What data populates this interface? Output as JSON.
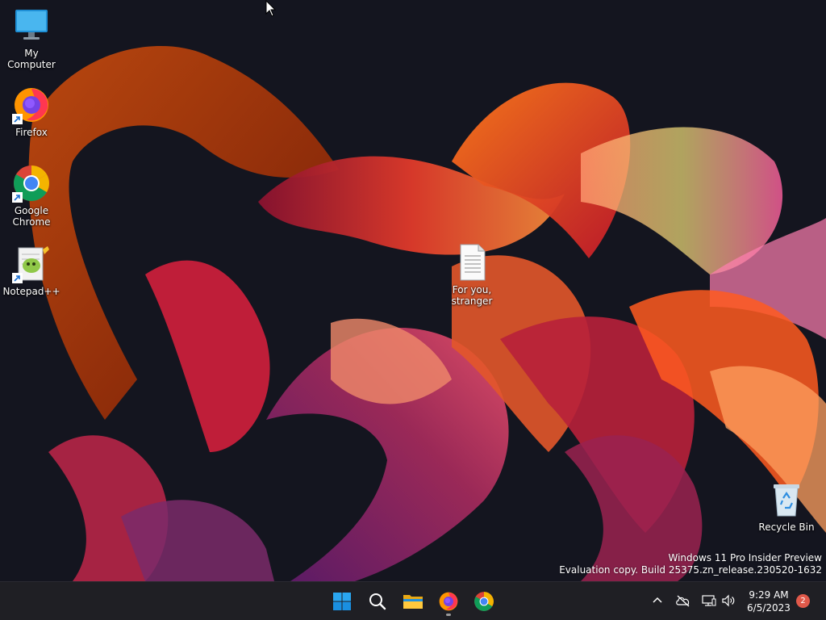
{
  "desktop": {
    "icons": [
      {
        "label": "My Computer",
        "icon": "monitor-icon"
      },
      {
        "label": "Firefox",
        "icon": "firefox-icon",
        "shortcut": true
      },
      {
        "label": "Google\nChrome",
        "icon": "chrome-icon",
        "shortcut": true
      },
      {
        "label": "Notepad++",
        "icon": "notepadplusplus-icon",
        "shortcut": true
      },
      {
        "label": "For you,\nstranger",
        "icon": "text-document-icon"
      },
      {
        "label": "Recycle Bin",
        "icon": "recycle-bin-icon"
      }
    ],
    "watermark": {
      "line1": "Windows 11 Pro Insider Preview",
      "line2": "Evaluation copy. Build 25375.zn_release.230520-1632"
    }
  },
  "taskbar": {
    "apps": [
      "start-icon",
      "search-icon",
      "file-explorer-icon",
      "firefox-icon",
      "chrome-icon"
    ],
    "tray": [
      "chevron-up-icon",
      "cloud-offline-icon",
      "network-icon",
      "volume-icon"
    ],
    "clock": {
      "time": "9:29 AM",
      "date": "6/5/2023"
    },
    "notification_count": "2"
  },
  "colors": {
    "taskbar_bg": "#1f1f24",
    "desktop_bg": "#14151f",
    "accent": "#0078d4",
    "badge": "#e0594a"
  }
}
